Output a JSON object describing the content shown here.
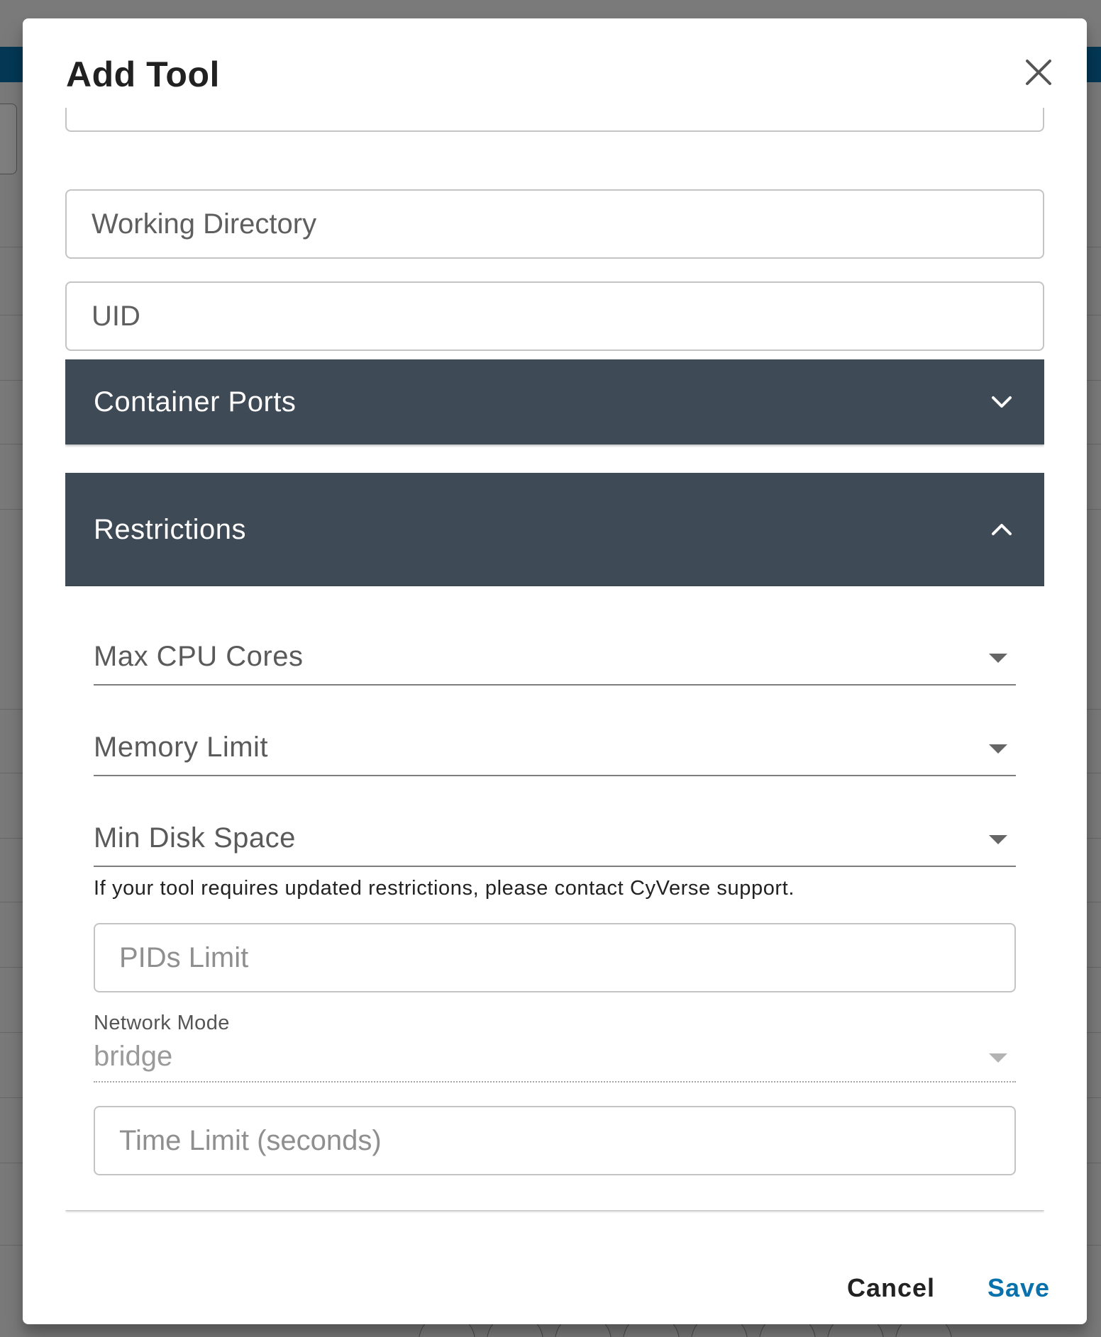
{
  "dialog": {
    "title": "Add Tool",
    "close_icon": "close-icon"
  },
  "fields": {
    "working_directory_placeholder": "Working Directory",
    "uid_placeholder": "UID"
  },
  "container_ports": {
    "label": "Container Ports",
    "icon": "chevron-down-icon"
  },
  "restrictions": {
    "label": "Restrictions",
    "icon": "chevron-up-icon",
    "max_cpu_cores": "Max CPU Cores",
    "memory_limit": "Memory Limit",
    "min_disk_space": "Min Disk Space",
    "helper_text": "If your tool requires updated restrictions, please contact CyVerse support.",
    "pids_limit_placeholder": "PIDs Limit",
    "network_mode_label": "Network Mode",
    "network_mode_value": "bridge",
    "time_limit_placeholder": "Time Limit (seconds)"
  },
  "actions": {
    "cancel": "Cancel",
    "save": "Save"
  },
  "colors": {
    "accordion_header": "#3f4a57",
    "primary": "#0971ab"
  }
}
